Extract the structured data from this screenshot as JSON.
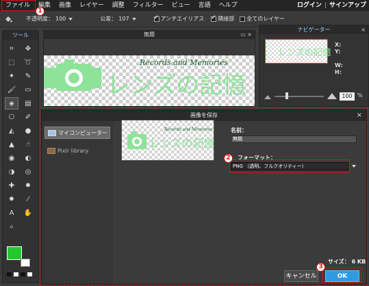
{
  "menubar": {
    "items": [
      "ファイル",
      "編集",
      "画像",
      "レイヤー",
      "調整",
      "フィルター",
      "ビュー",
      "言語",
      "ヘルプ"
    ],
    "login": "ログイン",
    "separator": "|",
    "signup": "サインアップ"
  },
  "options": {
    "tolerance_label": "不透明度：",
    "tolerance_value": "100",
    "fill_label": "公差：",
    "fill_value": "107",
    "antialias_label": "アンチエイリアス",
    "contiguous_label": "隣接部",
    "all_layers_label": "全てのレイヤー"
  },
  "tools": {
    "title": "ツール",
    "items": [
      "crop-icon",
      "move-icon",
      "marquee-icon",
      "lasso-icon",
      "wand-icon",
      "pencil-icon",
      "brush-icon",
      "eraser-icon",
      "bucket-icon",
      "gradient-icon",
      "stamp-icon",
      "colorreplace-icon",
      "drawing-icon",
      "blur-icon",
      "sharpen-icon",
      "smudge-icon",
      "sponge-icon",
      "dodge-icon",
      "burn-icon",
      "redeye-icon",
      "spot-heal-icon",
      "bloat-icon",
      "pinch-icon",
      "picker-icon",
      "type-icon",
      "hand-icon",
      "zoom-icon"
    ],
    "fg_color": "#22c92e",
    "bg_color": "#ffffff"
  },
  "document": {
    "title": "無題",
    "script_text": "Records and Memories",
    "main_text": "レンズの記憶"
  },
  "navigator": {
    "title": "ナビゲーター",
    "x_label": "X:",
    "y_label": "Y:",
    "w_label": "W:",
    "h_label": "H:",
    "zoom_value": "100",
    "zoom_unit": "%"
  },
  "dialog": {
    "title": "画像を保存",
    "close": "×",
    "sources": [
      "マイコンピューター",
      "Pixlr library"
    ],
    "name_label": "名前：",
    "name_value": "無題",
    "format_label": "フォーマット：",
    "format_value": "PNG （透明、フルクオリティー）",
    "size_label": "サイズ：",
    "size_value": "6 KB",
    "cancel_label": "キャンセル",
    "ok_label": "OK"
  },
  "annotations": {
    "step1": "1",
    "step2": "2",
    "step3": "3"
  },
  "colors": {
    "highlight": "#e01010",
    "accent_blue": "#2e9be0",
    "logo_green": "#8ee29a"
  }
}
